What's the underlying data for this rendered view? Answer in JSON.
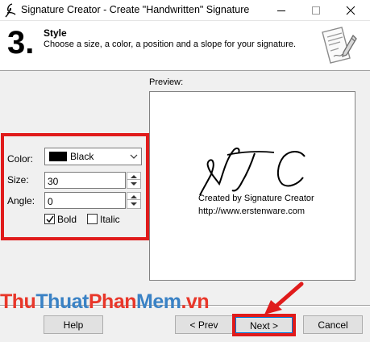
{
  "window": {
    "title": "Signature Creator - Create \"Handwritten\" Signature",
    "controls": [
      "minimize",
      "maximize",
      "close"
    ]
  },
  "header": {
    "step_number": "3.",
    "step_title": "Style",
    "step_description": "Choose a size, a color, a position and a slope for your signature."
  },
  "form": {
    "color_label": "Color:",
    "color_value": "Black",
    "color_swatch": "#000000",
    "size_label": "Size:",
    "size_value": "30",
    "angle_label": "Angle:",
    "angle_value": "0",
    "bold_label": "Bold",
    "bold_checked": true,
    "italic_label": "Italic",
    "italic_checked": false
  },
  "preview": {
    "label": "Preview:",
    "signature_text": "NTC",
    "credit_line1": "Created by Signature Creator",
    "credit_line2": "http://www.erstenware.com"
  },
  "watermark": {
    "part1": "Thu",
    "part2": "Thuat",
    "part3": "Phan",
    "part4": "Mem",
    "part5": ".vn"
  },
  "buttons": {
    "help": "Help",
    "prev": "< Prev",
    "next": "Next >",
    "cancel": "Cancel"
  },
  "colors": {
    "highlight": "#e01b1b",
    "watermark_red": "#e8372a",
    "watermark_blue": "#3a82c5"
  },
  "icons": [
    "signature-app-icon",
    "document-pen-icon",
    "chevron-down-icon",
    "spin-up-icon",
    "spin-down-icon",
    "checkmark-icon",
    "red-arrow-icon"
  ]
}
